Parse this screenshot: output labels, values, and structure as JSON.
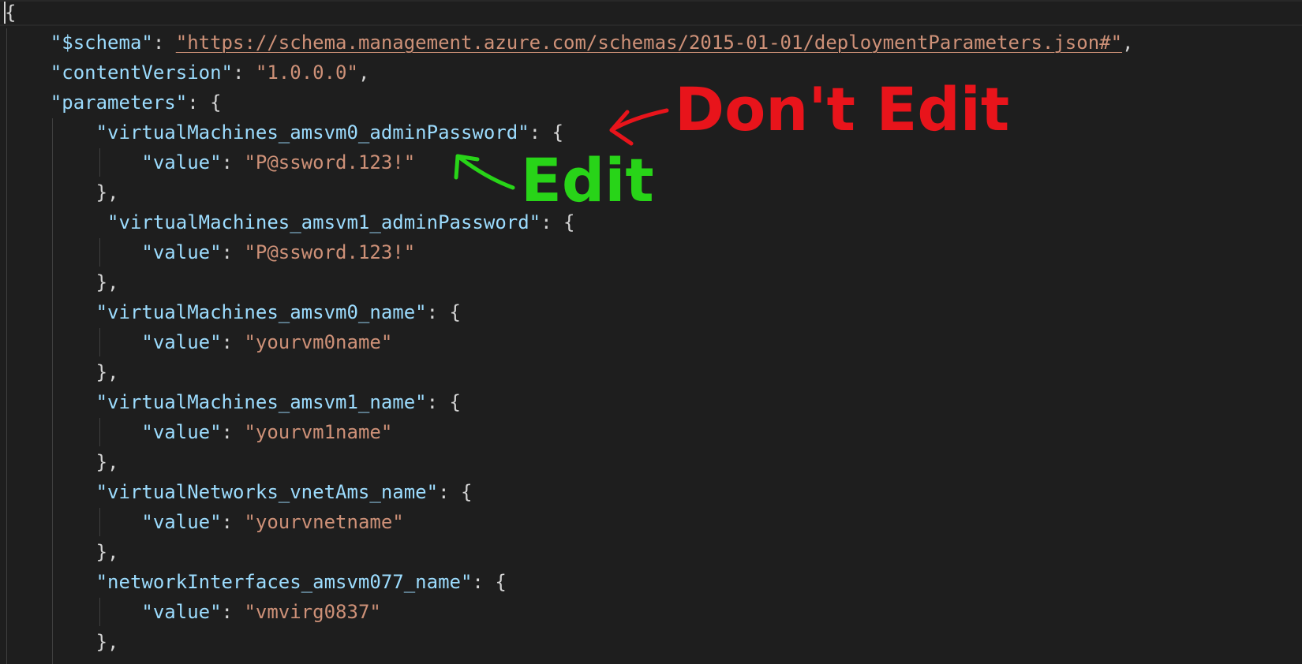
{
  "editor": {
    "lines": [
      {
        "indent": "",
        "key": "",
        "sep": "",
        "val": "",
        "tail": "{"
      },
      {
        "indent": "    ",
        "key": "\"$schema\"",
        "sep": ": ",
        "val": "\"https://schema.management.azure.com/schemas/2015-01-01/deploymentParameters.json#\"",
        "tail": ","
      },
      {
        "indent": "    ",
        "key": "\"contentVersion\"",
        "sep": ": ",
        "val": "\"1.0.0.0\"",
        "tail": ","
      },
      {
        "indent": "    ",
        "key": "\"parameters\"",
        "sep": ": ",
        "val": "",
        "tail": "{"
      },
      {
        "indent": "        ",
        "key": "\"virtualMachines_amsvm0_adminPassword\"",
        "sep": ": ",
        "val": "",
        "tail": "{"
      },
      {
        "indent": "            ",
        "key": "\"value\"",
        "sep": ": ",
        "val": "\"P@ssword.123!\"",
        "tail": ""
      },
      {
        "indent": "        ",
        "key": "",
        "sep": "",
        "val": "",
        "tail": "},"
      },
      {
        "indent": "         ",
        "key": "\"virtualMachines_amsvm1_adminPassword\"",
        "sep": ": ",
        "val": "",
        "tail": "{"
      },
      {
        "indent": "            ",
        "key": "\"value\"",
        "sep": ": ",
        "val": "\"P@ssword.123!\"",
        "tail": ""
      },
      {
        "indent": "        ",
        "key": "",
        "sep": "",
        "val": "",
        "tail": "},"
      },
      {
        "indent": "        ",
        "key": "\"virtualMachines_amsvm0_name\"",
        "sep": ": ",
        "val": "",
        "tail": "{"
      },
      {
        "indent": "            ",
        "key": "\"value\"",
        "sep": ": ",
        "val": "\"yourvm0name\"",
        "tail": ""
      },
      {
        "indent": "        ",
        "key": "",
        "sep": "",
        "val": "",
        "tail": "},"
      },
      {
        "indent": "        ",
        "key": "\"virtualMachines_amsvm1_name\"",
        "sep": ": ",
        "val": "",
        "tail": "{"
      },
      {
        "indent": "            ",
        "key": "\"value\"",
        "sep": ": ",
        "val": "\"yourvm1name\"",
        "tail": ""
      },
      {
        "indent": "        ",
        "key": "",
        "sep": "",
        "val": "",
        "tail": "},"
      },
      {
        "indent": "        ",
        "key": "\"virtualNetworks_vnetAms_name\"",
        "sep": ": ",
        "val": "",
        "tail": "{"
      },
      {
        "indent": "            ",
        "key": "\"value\"",
        "sep": ": ",
        "val": "\"yourvnetname\"",
        "tail": ""
      },
      {
        "indent": "        ",
        "key": "",
        "sep": "",
        "val": "",
        "tail": "},"
      },
      {
        "indent": "        ",
        "key": "\"networkInterfaces_amsvm077_name\"",
        "sep": ": ",
        "val": "",
        "tail": "{"
      },
      {
        "indent": "            ",
        "key": "\"value\"",
        "sep": ": ",
        "val": "\"vmvirg0837\"",
        "tail": ""
      },
      {
        "indent": "        ",
        "key": "",
        "sep": "",
        "val": "",
        "tail": "},"
      }
    ]
  },
  "annotations": {
    "dont_edit": "Don't Edit",
    "edit": "Edit",
    "dont_edit_color": "#e8141b",
    "edit_color": "#28d418"
  },
  "colors": {
    "background": "#1e1e1e",
    "key": "#9cdcfe",
    "string": "#ce9178",
    "punctuation": "#d4d4d4"
  }
}
